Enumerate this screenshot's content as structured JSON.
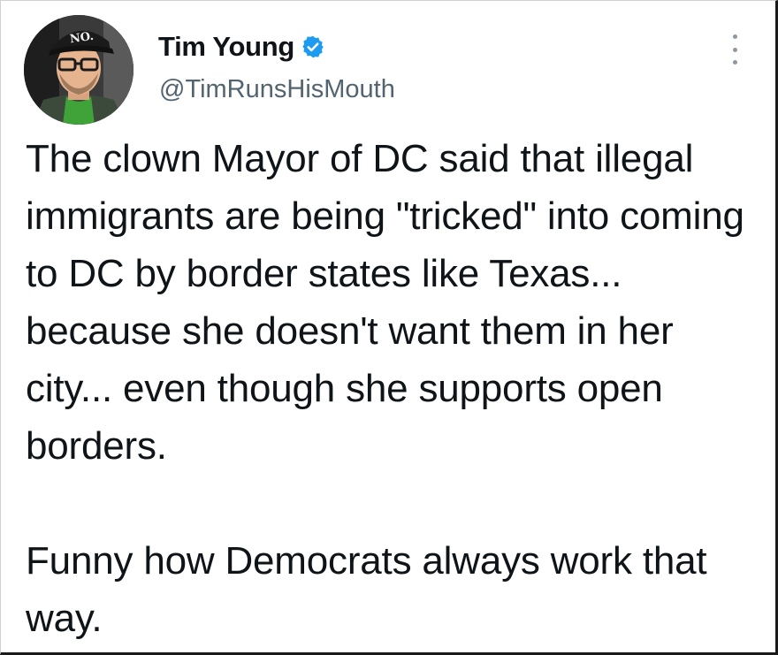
{
  "tweet": {
    "author": {
      "display_name": "Tim Young",
      "handle": "@TimRunsHisMouth",
      "verified": true,
      "avatar_hat_text": "NO."
    },
    "menu_icon": "more-options-icon",
    "paragraphs": [
      "The clown Mayor of DC said that illegal immigrants are being \"tricked\" into coming to DC by border states like Texas...  because she doesn't want them in her city... even though she supports open borders.",
      "Funny how Democrats always work that way."
    ],
    "colors": {
      "verified_badge": "#1d9bf0",
      "text_primary": "#0f1419",
      "text_secondary": "#536471"
    }
  }
}
